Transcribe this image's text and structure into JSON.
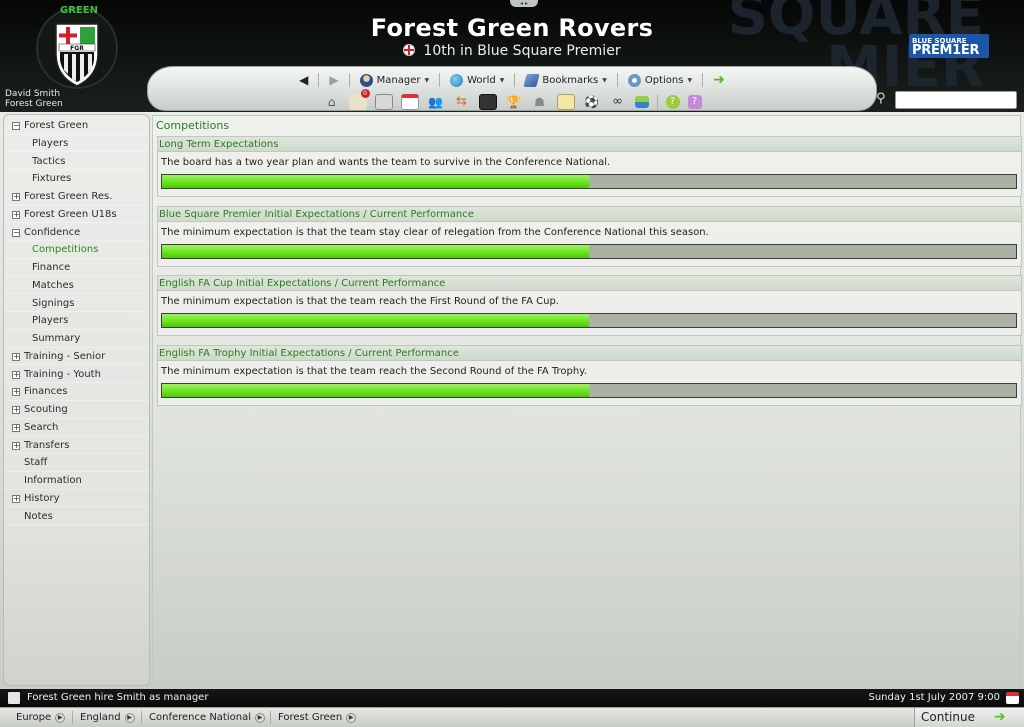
{
  "header": {
    "club_name": "Forest Green Rovers",
    "status": "10th in Blue Square Premier",
    "user_name": "David Smith",
    "user_club": "Forest Green",
    "crest_text": "GREEN",
    "league_logo_line1": "BLUE SQUARE",
    "league_logo_line2": "PREM1ER",
    "background_text": "SQUARE\nMIER"
  },
  "toolbar": {
    "back_icon": "back-arrow-icon",
    "forward_icon": "forward-arrow-icon",
    "menus": [
      {
        "label": "Manager",
        "icon": "manager-icon"
      },
      {
        "label": "World",
        "icon": "globe-icon"
      },
      {
        "label": "Bookmarks",
        "icon": "bookmarks-icon"
      },
      {
        "label": "Options",
        "icon": "options-icon"
      }
    ],
    "continue_icon": "green-arrow-icon",
    "icons": [
      "home-icon",
      "inbox-icon",
      "news-icon",
      "calendar-icon",
      "squad-icon",
      "transfers-icon",
      "tactics-board-icon",
      "trophy-icon",
      "staff-icon",
      "notes-icon",
      "match-icon",
      "scouting-icon",
      "finances-icon",
      "help-icon",
      "question-icon"
    ],
    "inbox_badge": "0"
  },
  "search": {
    "placeholder": ""
  },
  "sidebar": {
    "items": [
      {
        "label": "Forest Green",
        "expander": "−",
        "indent": 0,
        "active": false
      },
      {
        "label": "Players",
        "expander": "",
        "indent": 1,
        "active": false
      },
      {
        "label": "Tactics",
        "expander": "",
        "indent": 1,
        "active": false
      },
      {
        "label": "Fixtures",
        "expander": "",
        "indent": 1,
        "active": false
      },
      {
        "label": "Forest Green Res.",
        "expander": "+",
        "indent": 0,
        "active": false
      },
      {
        "label": "Forest Green U18s",
        "expander": "+",
        "indent": 0,
        "active": false
      },
      {
        "label": "Confidence",
        "expander": "−",
        "indent": 0,
        "active": false
      },
      {
        "label": "Competitions",
        "expander": "",
        "indent": 1,
        "active": true
      },
      {
        "label": "Finance",
        "expander": "",
        "indent": 1,
        "active": false
      },
      {
        "label": "Matches",
        "expander": "",
        "indent": 1,
        "active": false
      },
      {
        "label": "Signings",
        "expander": "",
        "indent": 1,
        "active": false
      },
      {
        "label": "Players",
        "expander": "",
        "indent": 1,
        "active": false
      },
      {
        "label": "Summary",
        "expander": "",
        "indent": 1,
        "active": false
      },
      {
        "label": "Training - Senior",
        "expander": "+",
        "indent": 0,
        "active": false
      },
      {
        "label": "Training - Youth",
        "expander": "+",
        "indent": 0,
        "active": false
      },
      {
        "label": "Finances",
        "expander": "+",
        "indent": 0,
        "active": false
      },
      {
        "label": "Scouting",
        "expander": "+",
        "indent": 0,
        "active": false
      },
      {
        "label": "Search",
        "expander": "+",
        "indent": 0,
        "active": false
      },
      {
        "label": "Transfers",
        "expander": "+",
        "indent": 0,
        "active": false
      },
      {
        "label": "Staff",
        "expander": "",
        "indent": 0,
        "active": false
      },
      {
        "label": "Information",
        "expander": "",
        "indent": 0,
        "active": false
      },
      {
        "label": "History",
        "expander": "+",
        "indent": 0,
        "active": false
      },
      {
        "label": "Notes",
        "expander": "",
        "indent": 0,
        "active": false
      }
    ]
  },
  "content": {
    "title": "Competitions",
    "panels": [
      {
        "heading": "Long Term Expectations",
        "text": "The board has a two year plan and wants the team to survive in the Conference National.",
        "progress": 0.5
      },
      {
        "heading": "Blue Square Premier Initial Expectations / Current Performance",
        "text": "The minimum expectation is that the team stay clear of relegation from the Conference National this season.",
        "progress": 0.5
      },
      {
        "heading": "English FA Cup Initial Expectations / Current Performance",
        "text": "The minimum expectation is that the team reach the First Round of the FA Cup.",
        "progress": 0.5
      },
      {
        "heading": "English FA Trophy Initial Expectations / Current Performance",
        "text": "The minimum expectation is that the team reach the Second Round of the FA Trophy.",
        "progress": 0.5
      }
    ]
  },
  "news_bar": {
    "headline": "Forest Green hire Smith as manager",
    "date": "Sunday 1st July 2007 9:00"
  },
  "bottom_bar": {
    "breadcrumbs": [
      "Europe",
      "England",
      "Conference National",
      "Forest Green"
    ],
    "continue_label": "Continue"
  },
  "colors": {
    "accent_green": "#2b7c1f",
    "progress_green": "#6fe81e",
    "header_bg": "#0d100f"
  }
}
